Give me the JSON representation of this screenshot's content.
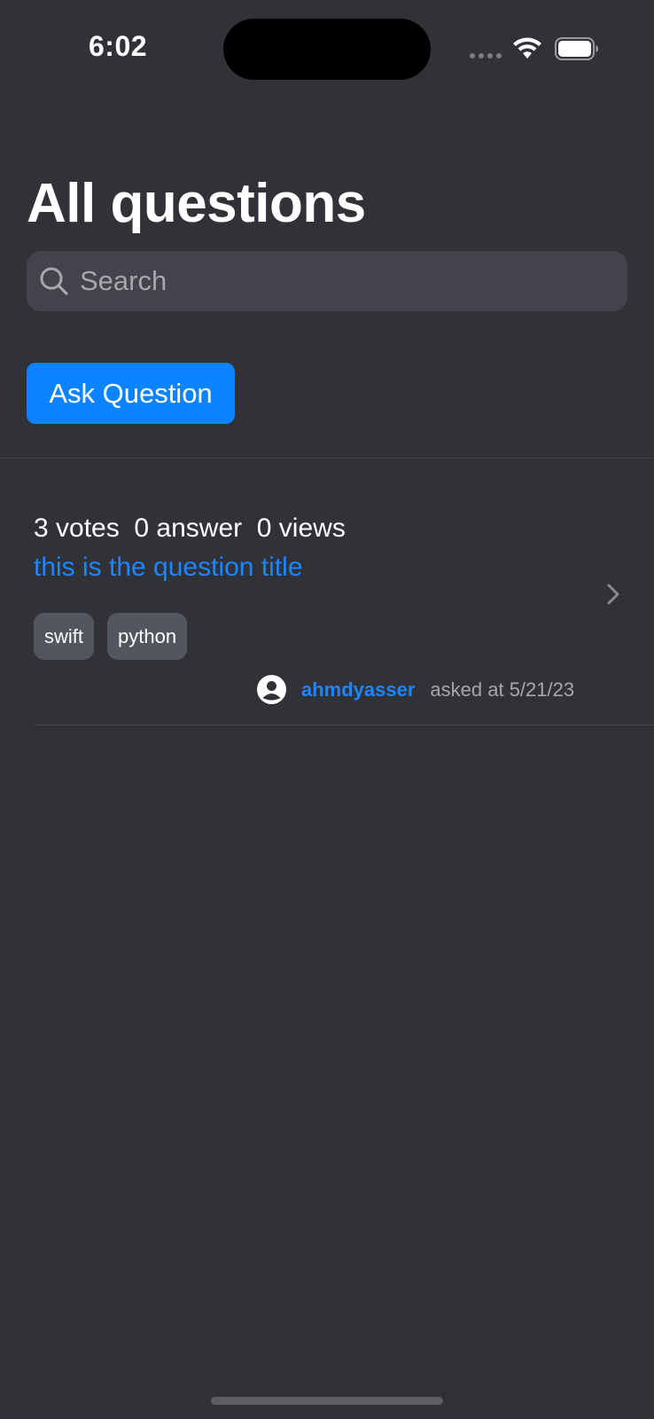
{
  "status_bar": {
    "time": "6:02",
    "icons": [
      "cellular-signal-icon",
      "wifi-icon",
      "battery-icon"
    ]
  },
  "header": {
    "title": "All questions"
  },
  "search": {
    "placeholder": "Search",
    "value": "",
    "icon": "search-icon"
  },
  "actions": {
    "ask_label": "Ask Question"
  },
  "questions": [
    {
      "stats": "3 votes  0 answer  0 views",
      "votes": 3,
      "answers": 0,
      "views": 0,
      "title": "this is the question title",
      "tags": [
        "swift",
        "python"
      ],
      "author": "ahmdyasser",
      "asked": "asked at 5/21/23"
    }
  ],
  "colors": {
    "background": "#313238",
    "accent": "#0c84ff",
    "link": "#1c86ff",
    "search_field": "#42434b",
    "tag_bg": "#53555f",
    "secondary_text": "#a6a7ad"
  }
}
